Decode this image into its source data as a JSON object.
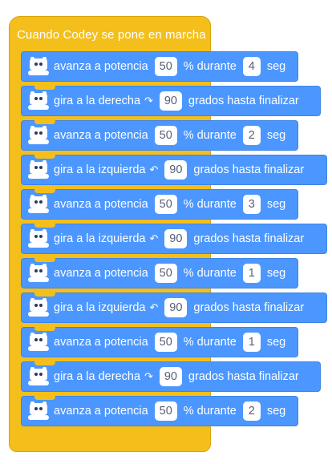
{
  "hat": {
    "label": "Cuando Codey se pone en marcha"
  },
  "blocks": [
    {
      "type": "move",
      "label": "avanza a potencia",
      "power": "50",
      "mid": "% durante",
      "duration": "4",
      "unit": "seg"
    },
    {
      "type": "turn",
      "label": "gira a la derecha",
      "arrow": "↷",
      "degrees": "90",
      "suffix": "grados hasta finalizar"
    },
    {
      "type": "move",
      "label": "avanza a potencia",
      "power": "50",
      "mid": "% durante",
      "duration": "2",
      "unit": "seg"
    },
    {
      "type": "turn",
      "label": "gira a la izquierda",
      "arrow": "↶",
      "degrees": "90",
      "suffix": "grados hasta finalizar"
    },
    {
      "type": "move",
      "label": "avanza a potencia",
      "power": "50",
      "mid": "% durante",
      "duration": "3",
      "unit": "seg"
    },
    {
      "type": "turn",
      "label": "gira a la izquierda",
      "arrow": "↶",
      "degrees": "90",
      "suffix": "grados hasta finalizar"
    },
    {
      "type": "move",
      "label": "avanza a potencia",
      "power": "50",
      "mid": "% durante",
      "duration": "1",
      "unit": "seg"
    },
    {
      "type": "turn",
      "label": "gira a la izquierda",
      "arrow": "↶",
      "degrees": "90",
      "suffix": "grados hasta finalizar"
    },
    {
      "type": "move",
      "label": "avanza a potencia",
      "power": "50",
      "mid": "% durante",
      "duration": "1",
      "unit": "seg"
    },
    {
      "type": "turn",
      "label": "gira a la derecha",
      "arrow": "↷",
      "degrees": "90",
      "suffix": "grados hasta finalizar"
    },
    {
      "type": "move",
      "label": "avanza a potencia",
      "power": "50",
      "mid": "% durante",
      "duration": "2",
      "unit": "seg"
    }
  ],
  "colors": {
    "hat": "#f5bf1b",
    "block": "#4c97ff",
    "field_text": "#575e75"
  },
  "icons": {
    "block_icon": "codey-robot-icon"
  }
}
